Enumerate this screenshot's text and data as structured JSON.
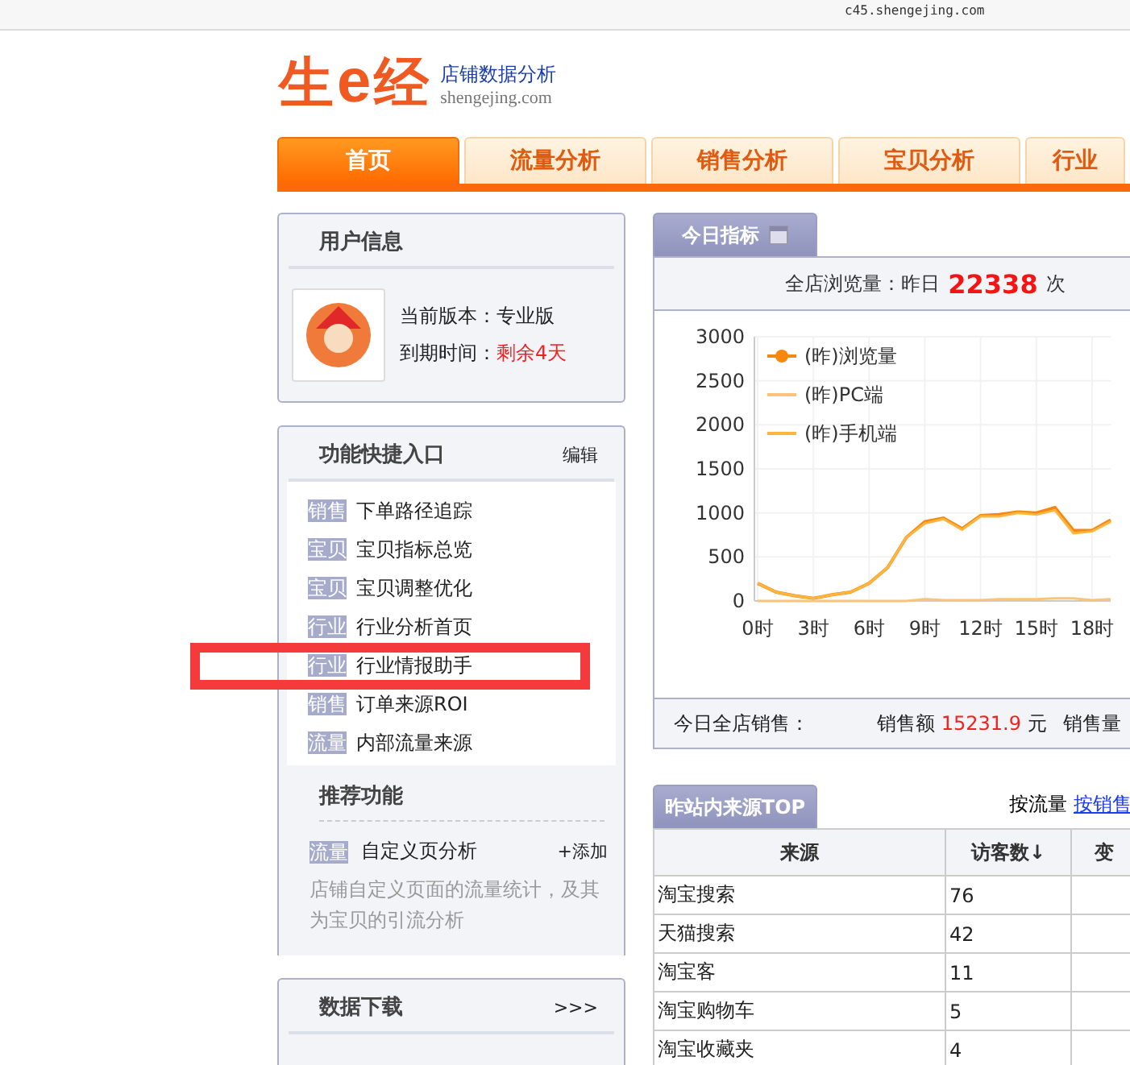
{
  "address_bar": {
    "url": "c45.shengejing.com"
  },
  "logo": {
    "mark_1": "生",
    "mark_2": "e",
    "mark_3": "经",
    "tagline": "店铺数据分析",
    "domain": "shengejing.com"
  },
  "tabs": [
    {
      "label": "首页",
      "selected": true
    },
    {
      "label": "流量分析",
      "selected": false
    },
    {
      "label": "销售分析",
      "selected": false
    },
    {
      "label": "宝贝分析",
      "selected": false
    },
    {
      "label": "行业",
      "selected": false
    }
  ],
  "user_info": {
    "title": "用户信息",
    "version_label": "当前版本：",
    "version": "专业版",
    "expiry_label": "到期时间：",
    "expiry": "剩余4天"
  },
  "shortcuts": {
    "title": "功能快捷入口",
    "edit": "编辑",
    "items": [
      {
        "tag": "销售",
        "label": "下单路径追踪"
      },
      {
        "tag": "宝贝",
        "label": "宝贝指标总览"
      },
      {
        "tag": "宝贝",
        "label": "宝贝调整优化"
      },
      {
        "tag": "行业",
        "label": "行业分析首页"
      },
      {
        "tag": "行业",
        "label": "行业情报助手"
      },
      {
        "tag": "销售",
        "label": "订单来源ROI"
      },
      {
        "tag": "流量",
        "label": "内部流量来源"
      }
    ]
  },
  "recommended": {
    "title": "推荐功能",
    "tag": "流量",
    "label": "自定义页分析",
    "add": "+添加",
    "description": "店铺自定义页面的流量统计，及其为宝贝的引流分析"
  },
  "downloads": {
    "title": "数据下载",
    "more": ">>>"
  },
  "today": {
    "tab": "今日指标",
    "pv_label": "全店浏览量：昨日",
    "pv_value": "22338",
    "pv_unit": "次",
    "chart_data": {
      "type": "line",
      "grid": true,
      "legend": "top-left inside",
      "xlim": [
        0,
        19
      ],
      "x": [
        0,
        1,
        2,
        3,
        4,
        5,
        6,
        7,
        8,
        9,
        10,
        11,
        12,
        13,
        14,
        15,
        16,
        17,
        18,
        19
      ],
      "ylim": [
        0,
        3000
      ],
      "yticks": [
        0,
        500,
        1000,
        1500,
        2000,
        2500,
        3000
      ],
      "xticks": [
        {
          "value": 0,
          "label": "0时"
        },
        {
          "value": 3,
          "label": "3时"
        },
        {
          "value": 6,
          "label": "6时"
        },
        {
          "value": 9,
          "label": "9时"
        },
        {
          "value": 12,
          "label": "12时"
        },
        {
          "value": 15,
          "label": "15时"
        },
        {
          "value": 18,
          "label": "18时"
        }
      ],
      "series": [
        {
          "name": "(昨)浏览量",
          "color": "#f7880f",
          "values": [
            200,
            100,
            60,
            30,
            70,
            100,
            200,
            380,
            720,
            900,
            940,
            820,
            970,
            980,
            1010,
            1000,
            1060,
            800,
            800,
            920
          ]
        },
        {
          "name": "(昨)PC端",
          "color": "#fbc27a",
          "values": [
            0,
            0,
            0,
            0,
            0,
            0,
            0,
            0,
            0,
            20,
            10,
            10,
            10,
            20,
            20,
            20,
            30,
            30,
            10,
            20
          ]
        },
        {
          "name": "(昨)手机端",
          "color": "#fcb640",
          "values": [
            200,
            100,
            60,
            30,
            70,
            100,
            200,
            380,
            720,
            880,
            930,
            810,
            960,
            960,
            1000,
            980,
            1030,
            770,
            790,
            900
          ]
        }
      ]
    },
    "sales_label": "今日全店销售：",
    "amount_label": "销售额",
    "amount": "15231.9",
    "amount_unit": "元",
    "qty_label": "销售量"
  },
  "sources": {
    "tab": "昨站内来源TOP",
    "sort_label": "按流量",
    "sort_link": "按销售",
    "columns": [
      "来源",
      "访客数↓",
      "变"
    ],
    "rows": [
      [
        "淘宝搜索",
        "76"
      ],
      [
        "天猫搜索",
        "42"
      ],
      [
        "淘宝客",
        "11"
      ],
      [
        "淘宝购物车",
        "5"
      ],
      [
        "淘宝收藏夹",
        "4"
      ]
    ]
  },
  "annotation": {
    "kind": "rectangle",
    "color": "#f43a3a"
  }
}
